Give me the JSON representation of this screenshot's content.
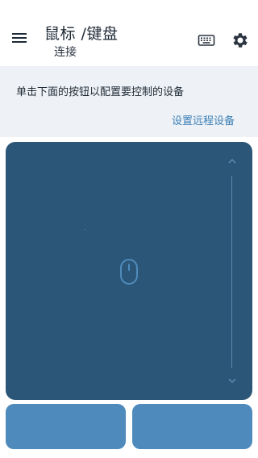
{
  "header": {
    "title": "鼠标 /键盘",
    "subtitle": "连接",
    "menu_icon": "hamburger-menu-icon",
    "keyboard_icon": "keyboard-icon",
    "settings_icon": "gear-icon"
  },
  "info": {
    "instruction": "单击下面的按钮以配置要控制的设备",
    "setup_link": "设置远程设备"
  },
  "touchpad": {
    "center_icon": "mouse-icon",
    "scroll_up_icon": "chevron-up-icon",
    "scroll_down_icon": "chevron-down-icon"
  },
  "colors": {
    "touchpad": "#2c5677",
    "mouse_buttons": "#4e8bbc",
    "info_background": "#eef2f6",
    "link": "#3b7fb6"
  }
}
